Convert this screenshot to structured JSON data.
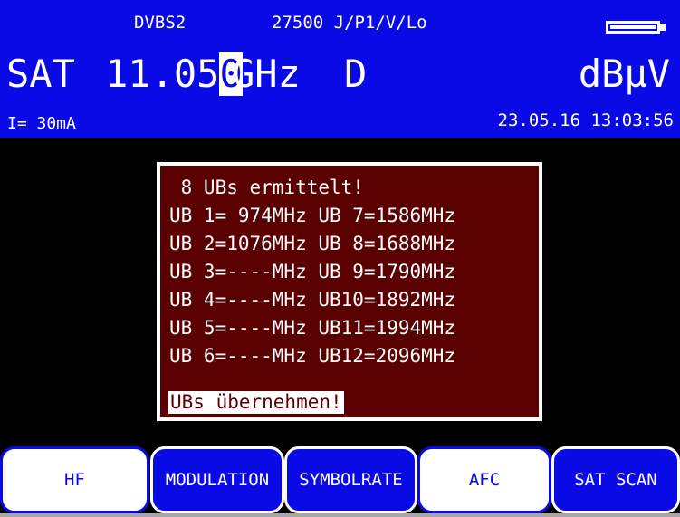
{
  "header": {
    "standard": "DVBS2",
    "params": "27500 J/P1/V/Lo",
    "band": "SAT",
    "freq_before": "11.05",
    "freq_cursor": "0",
    "unit": "GHz",
    "mode_flag": "D",
    "level_unit": "dBµV",
    "current": "I= 30mA",
    "datetime": "23.05.16 13:03:56"
  },
  "dialog": {
    "title": " 8 UBs ermittelt!",
    "lines": [
      "UB 1= 974MHz UB 7=1586MHz",
      "UB 2=1076MHz UB 8=1688MHz",
      "UB 3=----MHz UB 9=1790MHz",
      "UB 4=----MHz UB10=1892MHz",
      "UB 5=----MHz UB11=1994MHz",
      "UB 6=----MHz UB12=2096MHz"
    ],
    "confirm": "UBs übernehmen!"
  },
  "softkeys": [
    {
      "label": "HF",
      "selected": true
    },
    {
      "label": "MODULATION",
      "selected": false
    },
    {
      "label": "SYMBOLRATE",
      "selected": false
    },
    {
      "label": "AFC",
      "selected": true
    },
    {
      "label": "SAT SCAN",
      "selected": false
    }
  ],
  "colors": {
    "header_bg": "#0a0ae6",
    "dialog_bg": "#5a0000",
    "screen_bg": "#000000",
    "frame": "#a7a7a7"
  },
  "icons": {
    "battery": "battery-icon"
  }
}
